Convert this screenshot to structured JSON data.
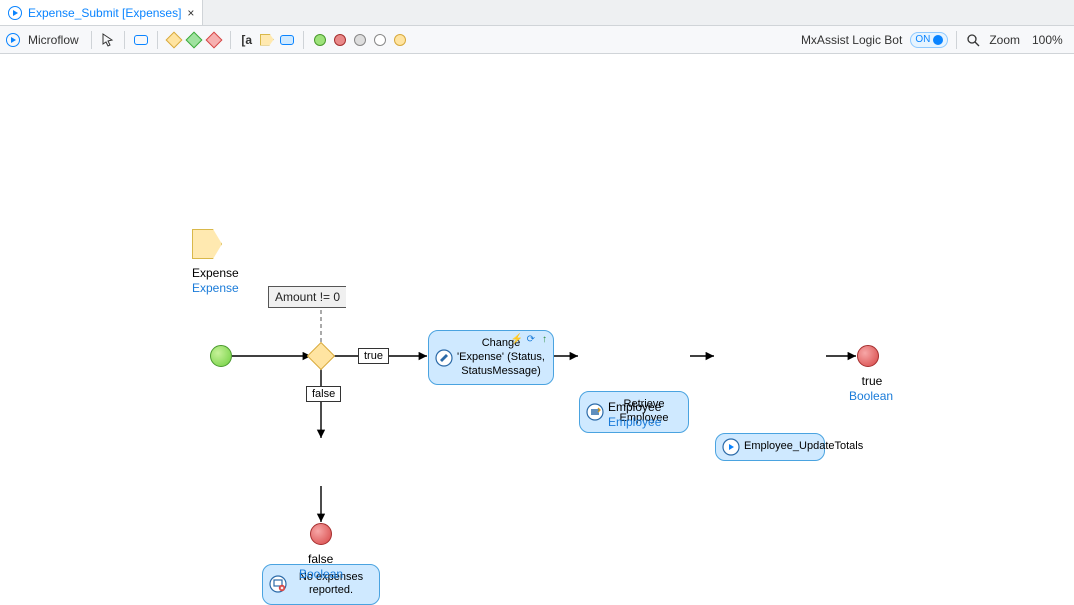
{
  "tab": {
    "title": "Expense_Submit [Expenses]"
  },
  "toolbar": {
    "microflow_label": "Microflow",
    "mxassist_label": "MxAssist Logic Bot",
    "mxassist_state": "ON",
    "zoom_label": "Zoom",
    "zoom_value": "100%"
  },
  "parameter": {
    "name": "Expense",
    "type": "Expense"
  },
  "decision": {
    "expression": "Amount != 0",
    "true_label": "true",
    "false_label": "false"
  },
  "activities": {
    "change": {
      "text": "Change 'Expense' (Status, StatusMessage)"
    },
    "retrieve": {
      "text": "Retrieve Employee",
      "out_name": "Employee",
      "out_type": "Employee"
    },
    "call": {
      "text": "Employee_UpdateTotals"
    },
    "validation": {
      "text": "No expenses reported."
    }
  },
  "ends": {
    "true": {
      "value": "true",
      "type": "Boolean"
    },
    "false": {
      "value": "false",
      "type": "Boolean"
    }
  }
}
